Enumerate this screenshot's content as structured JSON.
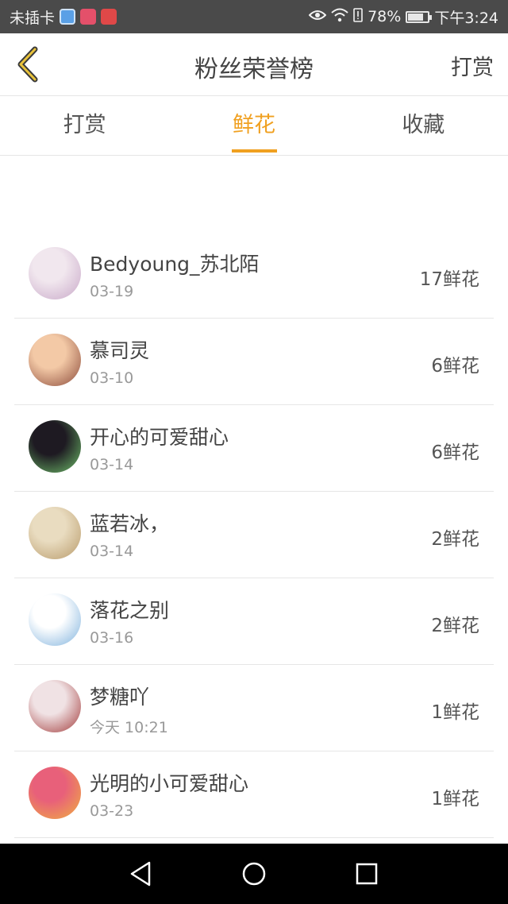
{
  "status_bar": {
    "carrier": "未插卡",
    "battery": "78%",
    "battery_level": 0.78,
    "time": "下午3:24",
    "icons": [
      "app-browser-icon",
      "app-shop-icon",
      "app-book-icon",
      "eye-icon",
      "wifi-icon",
      "alert-icon",
      "battery-icon"
    ]
  },
  "header": {
    "back_icon": "chevron-left-icon",
    "title": "粉丝荣誉榜",
    "action": "打赏"
  },
  "tabs": [
    {
      "label": "打赏",
      "active": false
    },
    {
      "label": "鲜花",
      "active": true
    },
    {
      "label": "收藏",
      "active": false
    }
  ],
  "colors": {
    "accent": "#f0a020",
    "divider": "#e5e5e5",
    "status_bar": "#4a4a4a",
    "nav_bar": "#000000"
  },
  "fans": [
    {
      "name": "Bedyoung_苏北陌",
      "date": "03-19",
      "count": "17鲜花",
      "avatar_colors": [
        "#f1e7ee",
        "#c8a8c8"
      ]
    },
    {
      "name": "慕司灵",
      "date": "03-10",
      "count": "6鲜花",
      "avatar_colors": [
        "#f3c9a6",
        "#8b4a3a"
      ]
    },
    {
      "name": "开心的可爱甜心",
      "date": "03-14",
      "count": "6鲜花",
      "avatar_colors": [
        "#1e1a22",
        "#6fbf6a"
      ]
    },
    {
      "name": "蓝若冰，",
      "date": "03-14",
      "count": "2鲜花",
      "avatar_colors": [
        "#e9dcc0",
        "#b89a6a"
      ]
    },
    {
      "name": "落花之别",
      "date": "03-16",
      "count": "2鲜花",
      "avatar_colors": [
        "#ffffff",
        "#7fb2dd"
      ]
    },
    {
      "name": "梦糖吖",
      "date": "今天 10:21",
      "count": "1鲜花",
      "avatar_colors": [
        "#f0e2e4",
        "#a23a3a"
      ]
    },
    {
      "name": "光明的小可爱甜心",
      "date": "03-23",
      "count": "1鲜花",
      "avatar_colors": [
        "#e8607a",
        "#f0b040"
      ]
    }
  ],
  "nav_bar": {
    "icons": [
      "nav-back-icon",
      "nav-home-icon",
      "nav-recents-icon"
    ]
  }
}
